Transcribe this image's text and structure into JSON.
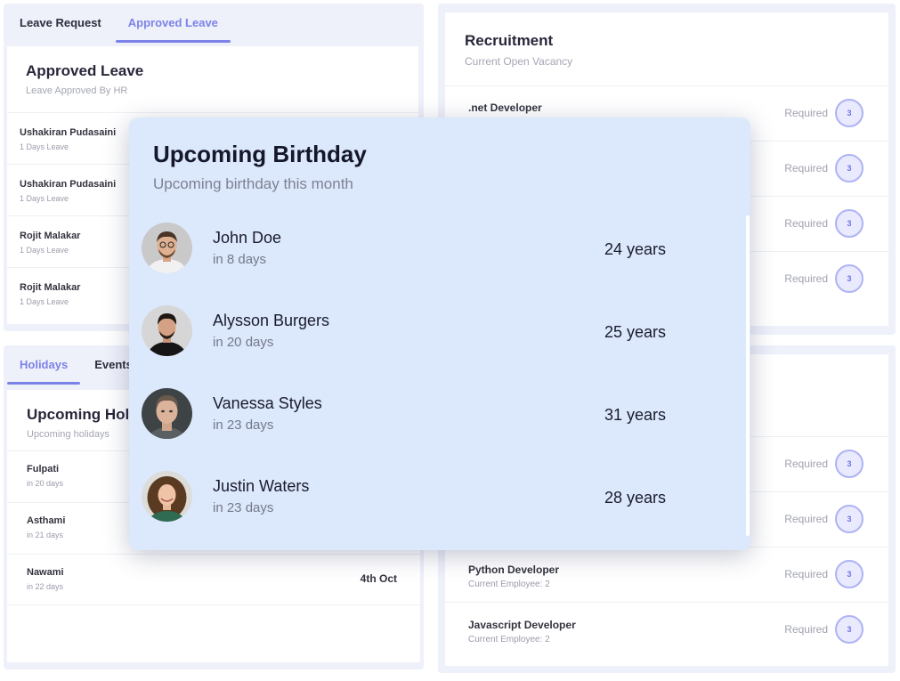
{
  "leave": {
    "tabs": [
      "Leave Request",
      "Approved Leave"
    ],
    "title": "Approved Leave",
    "subtitle": "Leave Approved By HR",
    "rows": [
      {
        "name": "Ushakiran Pudasaini",
        "meta": "1 Days Leave"
      },
      {
        "name": "Ushakiran Pudasaini",
        "meta": "1 Days Leave"
      },
      {
        "name": "Rojit Malakar",
        "meta": "1 Days Leave"
      },
      {
        "name": "Rojit Malakar",
        "meta": "1 Days Leave"
      }
    ]
  },
  "recruitment": {
    "title": "Recruitment",
    "subtitle": "Current Open Vacancy",
    "required_label": "Required",
    "rows": [
      {
        "role": ".net Developer",
        "count": "3"
      },
      {
        "count": "3"
      },
      {
        "count": "3"
      },
      {
        "count": "3"
      }
    ]
  },
  "holidays": {
    "tabs": [
      "Holidays",
      "Events"
    ],
    "title": "Upcoming Holidays",
    "subtitle": "Upcoming holidays",
    "rows": [
      {
        "name": "Fulpati",
        "meta": "in 20 days",
        "date": ""
      },
      {
        "name": "Asthami",
        "meta": "in 21 days",
        "date": ""
      },
      {
        "name": "Nawami",
        "meta": "in 22 days",
        "date": "4th Oct"
      }
    ]
  },
  "employees": {
    "required_label": "Required",
    "rows": [
      {
        "role": "",
        "meta": "",
        "count": "3"
      },
      {
        "role": "",
        "meta": "",
        "count": "3"
      },
      {
        "role": "Python Developer",
        "meta": "Current Employee: 2",
        "count": "3"
      },
      {
        "role": "Javascript Developer",
        "meta": "Current Employee: 2",
        "count": "3"
      }
    ]
  },
  "birthday": {
    "title": "Upcoming Birthday",
    "subtitle": "Upcoming birthday this month",
    "people": [
      {
        "name": "John Doe",
        "days": "in 8 days",
        "age": "24 years"
      },
      {
        "name": "Alysson Burgers",
        "days": "in 20 days",
        "age": "25 years"
      },
      {
        "name": "Vanessa Styles",
        "days": "in 23 days",
        "age": "31 years"
      },
      {
        "name": "Justin Waters",
        "days": "in 23 days",
        "age": "28 years"
      }
    ]
  },
  "colors": {
    "accent": "#7c83e8",
    "modal_bg": "#dce8fb",
    "panel_bg": "#eef0fa"
  }
}
